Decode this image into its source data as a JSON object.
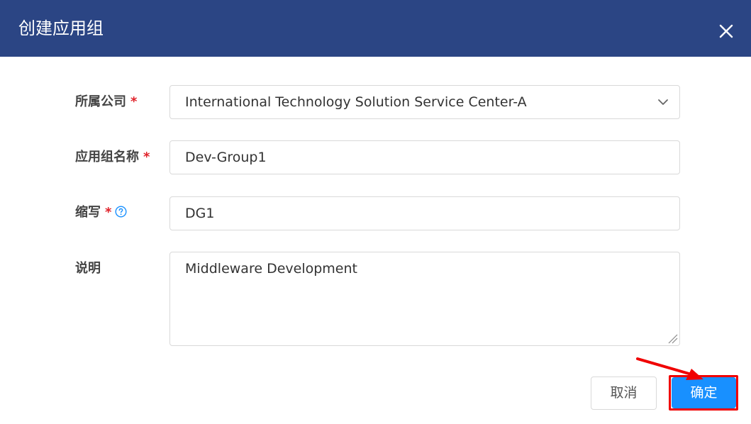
{
  "dialog": {
    "title": "创建应用组",
    "close_icon": "close-icon"
  },
  "form": {
    "company": {
      "label": "所属公司",
      "required_mark": "*",
      "value": "International Technology Solution Service Center-A"
    },
    "group_name": {
      "label": "应用组名称",
      "required_mark": "*",
      "value": "Dev-Group1"
    },
    "abbreviation": {
      "label": "缩写",
      "required_mark": "*",
      "help_icon": "question-circle-icon",
      "value": "DG1"
    },
    "description": {
      "label": "说明",
      "value": "Middleware Development"
    }
  },
  "footer": {
    "cancel_label": "取消",
    "confirm_label": "确定"
  },
  "colors": {
    "header_bg": "#2b4584",
    "primary": "#1890ff",
    "required": "#e0222a",
    "annotation": "#f00000"
  }
}
